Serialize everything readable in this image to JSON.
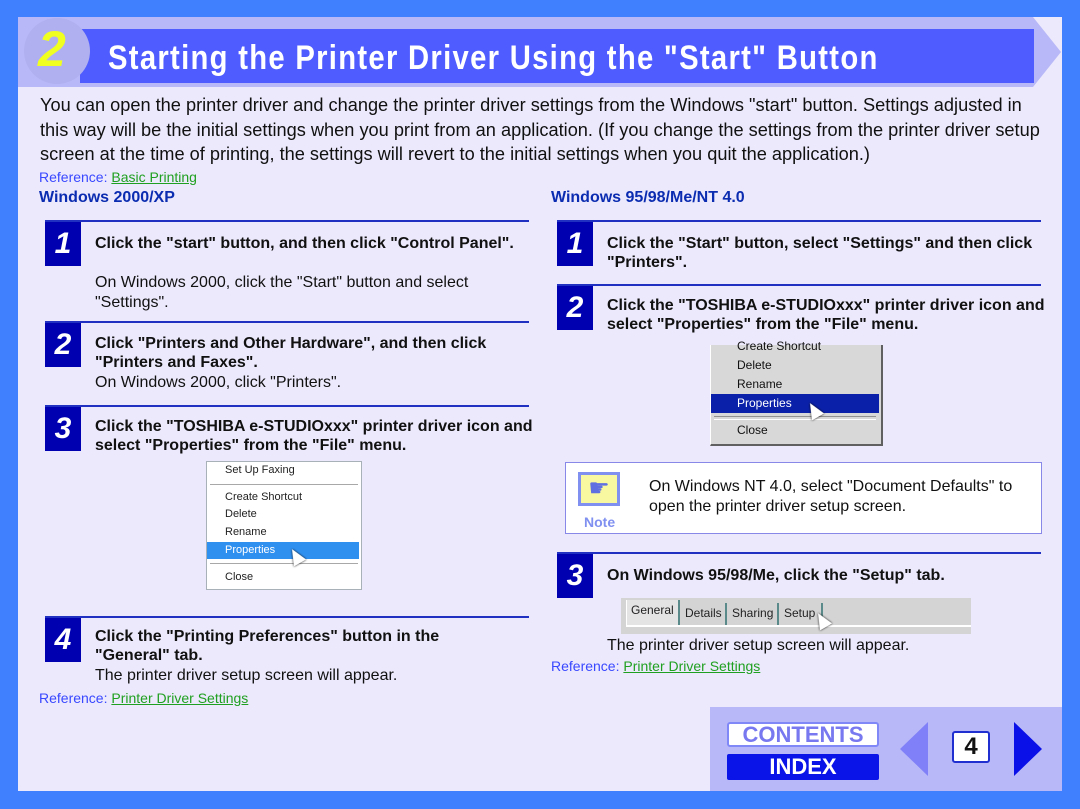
{
  "header": {
    "section_number": "2",
    "title": "Starting the Printer Driver Using the \"Start\" Button"
  },
  "intro": "You can open the printer driver and change the printer driver settings from the Windows \"start\" button. Settings adjusted in this way will be the initial settings when you print from an application. (If you change the settings from the printer driver setup screen at the time of printing, the settings will revert to the initial settings when you quit the application.)",
  "top_reference": {
    "label": "Reference: ",
    "link": "Basic Printing"
  },
  "left": {
    "heading": "Windows 2000/XP",
    "steps": [
      {
        "num": "1",
        "bold": "Click the \"start\" button, and then click \"Control Panel\".",
        "text": "On Windows 2000, click the \"Start\" button and select \"Settings\"."
      },
      {
        "num": "2",
        "bold": "Click \"Printers and Other Hardware\", and then click \"Printers and Faxes\".",
        "text": "On Windows 2000, click \"Printers\"."
      },
      {
        "num": "3",
        "bold": "Click the \"TOSHIBA e-STUDIOxxx\" printer driver icon and  select \"Properties\" from the \"File\" menu.",
        "text": ""
      },
      {
        "num": "4",
        "bold": "Click the \"Printing Preferences\" button in the \"General\" tab.",
        "text": "The printer driver setup screen will appear."
      }
    ],
    "menu": [
      "Set Up Faxing",
      "Create Shortcut",
      "Delete",
      "Rename",
      "Properties",
      "Close"
    ],
    "reference": {
      "label": "Reference: ",
      "link": "Printer Driver Settings"
    }
  },
  "right": {
    "heading": "Windows 95/98/Me/NT 4.0",
    "steps": [
      {
        "num": "1",
        "bold": "Click the \"Start\" button, select \"Settings\" and then click \"Printers\"."
      },
      {
        "num": "2",
        "bold": "Click the \"TOSHIBA e-STUDIOxxx\" printer driver icon and select \"Properties\" from the \"File\" menu."
      },
      {
        "num": "3",
        "bold": "On Windows 95/98/Me, click the \"Setup\" tab.",
        "text": "The printer driver setup screen will appear."
      }
    ],
    "menu": [
      "Create Shortcut",
      "Delete",
      "Rename",
      "Properties",
      "Close"
    ],
    "note": {
      "label": "Note",
      "text": "On Windows NT 4.0, select \"Document Defaults\" to open the printer driver setup screen."
    },
    "tabs": [
      "General",
      "Details",
      "Sharing",
      "Setup"
    ],
    "reference": {
      "label": "Reference: ",
      "link": "Printer Driver Settings"
    }
  },
  "nav": {
    "contents": "CONTENTS",
    "index": "INDEX",
    "page": "4"
  }
}
